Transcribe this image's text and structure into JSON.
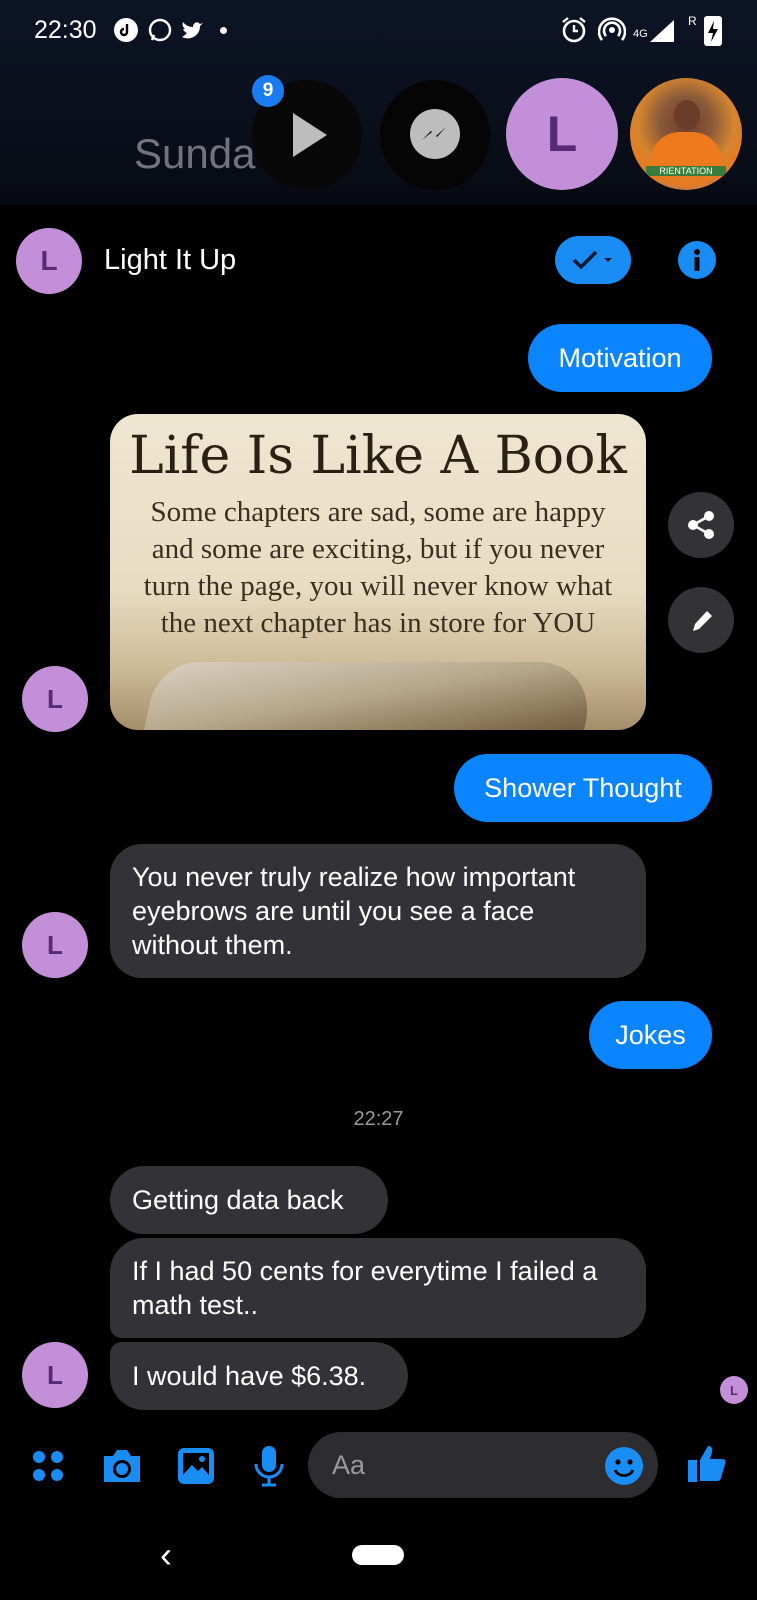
{
  "status_bar": {
    "time": "22:30",
    "left_icons": [
      "tiktok-icon",
      "whatsapp-icon",
      "twitter-icon",
      "dot-icon"
    ],
    "right_icons": [
      "alarm-icon",
      "hotspot-icon",
      "network-4g-icon",
      "signal-icon",
      "battery-charging-icon"
    ],
    "network_label": "4G",
    "roaming": "R"
  },
  "chat_heads": {
    "background_text": "Sunda     D",
    "badge_count": "9",
    "items": [
      "play-icon",
      "messenger-icon",
      "L",
      "profile-photo"
    ],
    "photo_caption": "RIENTATION"
  },
  "header": {
    "avatar_letter": "L",
    "title": "Light It Up",
    "accent": "#1a8df5"
  },
  "messages": {
    "m1": "Motivation",
    "image": {
      "heading": "Life Is Like A Book",
      "body": "Some chapters are sad, some are happy\nand some are exciting, but if you never\nturn the page, you will never know what\nthe next chapter has in store for YOU"
    },
    "m2": "Shower Thought",
    "m3": "You never truly realize how important eyebrows are until you see a face without them.",
    "m4": "Jokes",
    "timestamp": "22:27",
    "m5": "Getting data back",
    "m6": "If I had 50 cents for everytime I failed a math test..",
    "m7": "I would have $6.38.",
    "avatar_letter": "L",
    "seen_letter": "L"
  },
  "composer": {
    "placeholder": "Aa",
    "icons": [
      "menu-dots-icon",
      "camera-icon",
      "gallery-icon",
      "mic-icon",
      "emoji-icon",
      "thumbs-up-icon"
    ]
  },
  "nav": {
    "back_glyph": "‹"
  },
  "colors": {
    "outgoing": "#0a84ff",
    "incoming": "#333337",
    "avatar": "#c38fd8"
  }
}
